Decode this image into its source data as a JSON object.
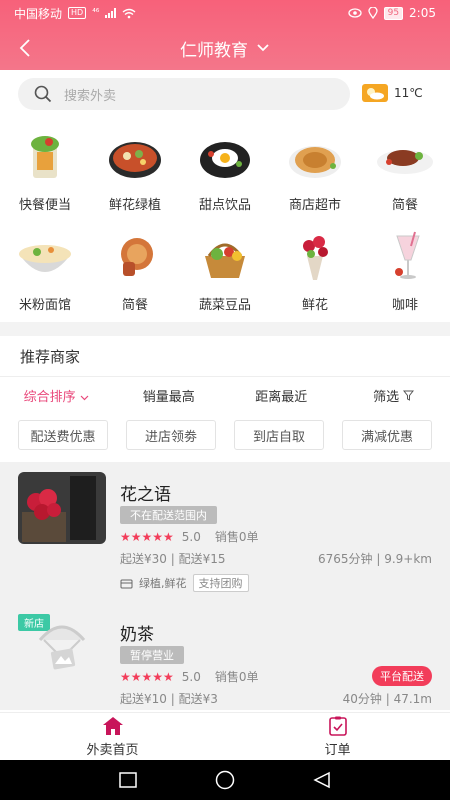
{
  "status_bar": {
    "carrier": "中国移动",
    "network_badge": "HD",
    "signal": "⁴⁶",
    "battery": "95",
    "time": "2:05"
  },
  "header": {
    "title": "仁师教育"
  },
  "search": {
    "placeholder": "搜索外卖"
  },
  "weather": {
    "temperature": "11℃"
  },
  "categories": [
    {
      "label": "快餐便当",
      "icon": "fast-food-icon"
    },
    {
      "label": "鲜花绿植",
      "icon": "hotpot-icon"
    },
    {
      "label": "甜点饮品",
      "icon": "fried-egg-icon"
    },
    {
      "label": "商店超市",
      "icon": "pancake-icon"
    },
    {
      "label": "简餐",
      "icon": "steak-icon"
    },
    {
      "label": "米粉面馆",
      "icon": "noodle-bowl-icon"
    },
    {
      "label": "简餐",
      "icon": "bread-icon"
    },
    {
      "label": "蔬菜豆品",
      "icon": "vegetable-basket-icon"
    },
    {
      "label": "鲜花",
      "icon": "flower-bouquet-icon"
    },
    {
      "label": "咖啡",
      "icon": "drink-glass-icon"
    }
  ],
  "section_title": "推荐商家",
  "sort": {
    "comprehensive": "综合排序",
    "sales": "销量最高",
    "distance": "距离最近",
    "filter": "筛选"
  },
  "filters": [
    "配送费优惠",
    "进店领劵",
    "到店自取",
    "满减优惠"
  ],
  "shops": [
    {
      "name": "花之语",
      "tag": "不在配送范围内",
      "rating": "5.0",
      "sales": "销售0单",
      "min_order": "起送¥30 | 配送¥15",
      "distance": "6765分钟 | 9.9+km",
      "categories": "绿植,鲜花",
      "group_buy": "支持团购"
    },
    {
      "badge": "新店",
      "name": "奶茶",
      "tag": "暂停营业",
      "rating": "5.0",
      "sales": "销售0单",
      "platform": "平台配送",
      "min_order": "起送¥10 | 配送¥3",
      "distance": "40分钟 | 47.1m"
    }
  ],
  "tabbar": {
    "home": "外卖首页",
    "orders": "订单"
  },
  "colors": {
    "accent": "#f4687f",
    "active": "#e9477a",
    "star": "#f23d5a",
    "new_badge": "#3cc9a5"
  }
}
